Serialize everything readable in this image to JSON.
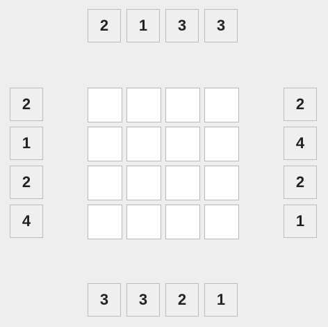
{
  "puzzle": {
    "size": 4,
    "clues": {
      "top": [
        "2",
        "1",
        "3",
        "3"
      ],
      "bottom": [
        "3",
        "3",
        "2",
        "1"
      ],
      "left": [
        "2",
        "1",
        "2",
        "4"
      ],
      "right": [
        "2",
        "4",
        "2",
        "1"
      ]
    },
    "grid": [
      [
        "",
        "",
        "",
        ""
      ],
      [
        "",
        "",
        "",
        ""
      ],
      [
        "",
        "",
        "",
        ""
      ],
      [
        "",
        "",
        "",
        ""
      ]
    ]
  }
}
